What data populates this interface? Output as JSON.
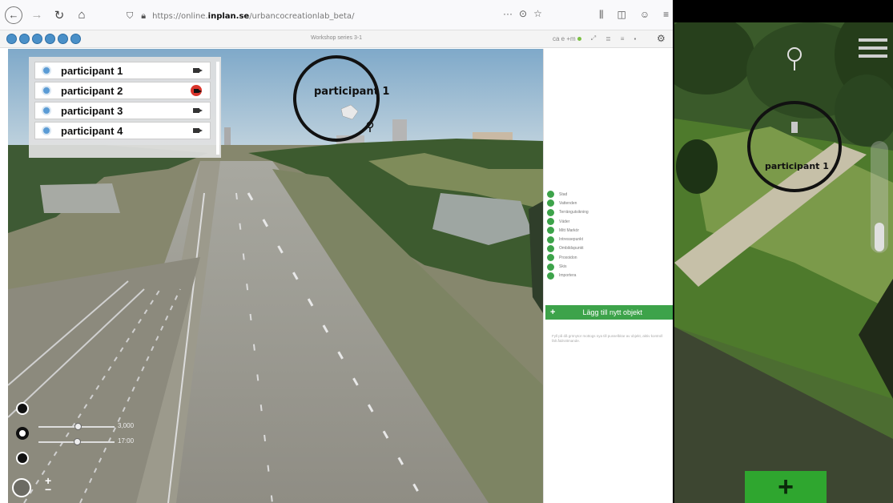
{
  "browser": {
    "url_prefix": "https://online.",
    "url_domain": "inplan.se",
    "url_path": "/urbancocreationlab_beta/",
    "page_actions": "···"
  },
  "app": {
    "workshop_title": "Workshop series 3-1",
    "status_text": "ca e +m"
  },
  "participants": [
    {
      "name": "participant 1",
      "camera_active": false
    },
    {
      "name": "participant 2",
      "camera_active": true
    },
    {
      "name": "participant 3",
      "camera_active": false
    },
    {
      "name": "participant 4",
      "camera_active": false
    }
  ],
  "scene": {
    "annotation_label": "participant 1",
    "slider_1_value": "3,000",
    "slider_2_value": "17:00"
  },
  "object_panel": {
    "items": [
      "Stad",
      "Vattenden",
      "Terrängutsikning",
      "Väder",
      "Mitt Markör",
      "Intressepunkt",
      "Ombildspunkt",
      "Proxoidon",
      "Skis",
      "Importera"
    ],
    "add_button_label": "Lägg till nytt objekt",
    "note": "Fyll på då grönytor mottogs nya till pusselbitar av objekt, aktiv kontroll fält åtdrottmande."
  },
  "mobile": {
    "annotation_label": "participant 1"
  },
  "colors": {
    "accent_green": "#3da34a",
    "camera_active": "#d9342b",
    "participant_icon": "#5a9bd5"
  }
}
